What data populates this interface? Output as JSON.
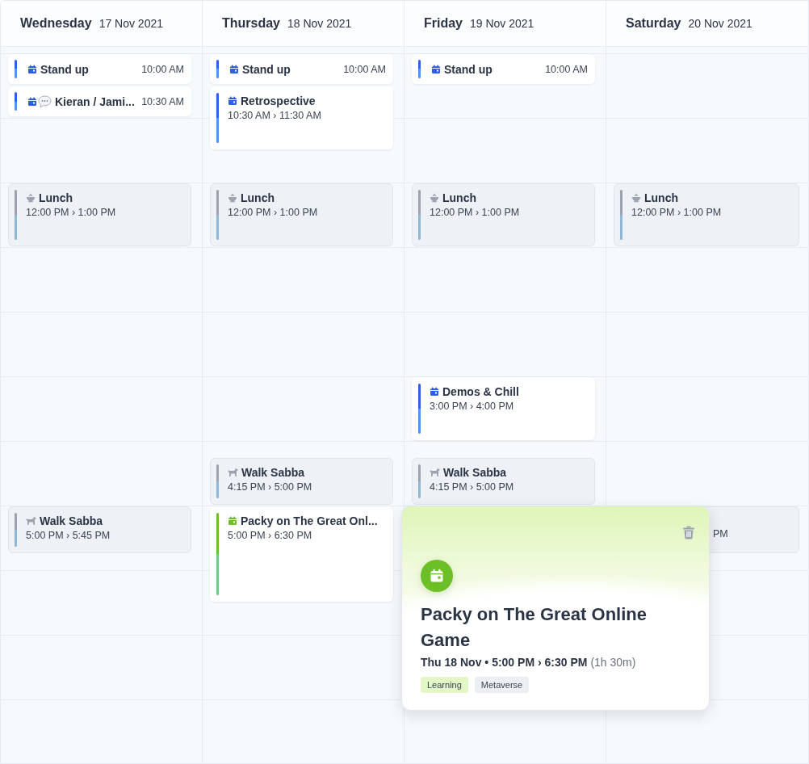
{
  "days": [
    {
      "weekday": "Wednesday",
      "date": "17 Nov 2021",
      "events": [
        {
          "kind": "compact",
          "title": "Stand up",
          "time": "10:00 AM",
          "color": "#2f5fe6"
        },
        {
          "kind": "compact",
          "title": "Kieran / Jami...",
          "time": "10:30 AM",
          "color": "#2f5fe6"
        },
        {
          "kind": "personal",
          "title": "Lunch",
          "time": "12:00 PM › 1:00 PM",
          "color": "#9ca3af"
        },
        {
          "kind": "personal",
          "title": "Walk Sabba",
          "time": "5:00 PM › 5:45 PM",
          "color": "#9ca3af"
        }
      ]
    },
    {
      "weekday": "Thursday",
      "date": "18 Nov 2021",
      "events": [
        {
          "kind": "compact",
          "title": "Stand up",
          "time": "10:00 AM",
          "color": "#2f5fe6"
        },
        {
          "kind": "block",
          "title": "Retrospective",
          "time": "10:30 AM › 11:30 AM",
          "color": "#2f5fe6"
        },
        {
          "kind": "personal",
          "title": "Lunch",
          "time": "12:00 PM › 1:00 PM",
          "color": "#9ca3af"
        },
        {
          "kind": "personal",
          "title": "Walk Sabba",
          "time": "4:15 PM › 5:00 PM",
          "color": "#9ca3af"
        },
        {
          "kind": "block",
          "title": "Packy on The Great Onl...",
          "time": "5:00 PM › 6:30 PM",
          "color": "#6cbf26"
        }
      ]
    },
    {
      "weekday": "Friday",
      "date": "19 Nov 2021",
      "events": [
        {
          "kind": "compact",
          "title": "Stand up",
          "time": "10:00 AM",
          "color": "#2f5fe6"
        },
        {
          "kind": "personal",
          "title": "Lunch",
          "time": "12:00 PM › 1:00 PM",
          "color": "#9ca3af"
        },
        {
          "kind": "block",
          "title": "Demos & Chill",
          "time": "3:00 PM › 4:00 PM",
          "color": "#2f5fe6"
        },
        {
          "kind": "personal",
          "title": "Walk Sabba",
          "time": "4:15 PM › 5:00 PM",
          "color": "#9ca3af"
        }
      ]
    },
    {
      "weekday": "Saturday",
      "date": "20 Nov 2021",
      "events": [
        {
          "kind": "personal",
          "title": "Lunch",
          "time": "12:00 PM › 1:00 PM",
          "color": "#9ca3af"
        },
        {
          "kind": "covered",
          "time": "PM"
        }
      ]
    }
  ],
  "popover": {
    "title": "Packy on The Great Online Game",
    "when": "Thu 18 Nov • 5:00 PM › 6:30 PM",
    "duration": "(1h 30m)",
    "color": "#6cbf26",
    "tags": [
      {
        "label": "Learning",
        "color": "#e3f7c6"
      },
      {
        "label": "Metaverse",
        "color": "#eceff4"
      }
    ]
  }
}
